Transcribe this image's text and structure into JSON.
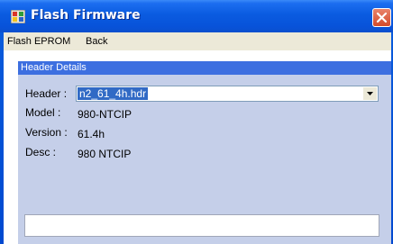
{
  "window": {
    "title": "Flash Firmware"
  },
  "menu": {
    "items": [
      "Flash EPROM",
      "Back"
    ]
  },
  "panel": {
    "header": "Header Details",
    "header_label": "Header :",
    "header_value": "n2_61_4h.hdr",
    "model_label": "Model :",
    "model_value": "980-NTCIP",
    "version_label": "Version :",
    "version_value": "61.4h",
    "desc_label": "Desc :",
    "desc_value": "980 NTCIP",
    "status_value": ""
  },
  "icons": {
    "app": "firmware-app-icon",
    "close": "close-icon",
    "dropdown": "chevron-down-icon"
  },
  "colors": {
    "titlebar": "#0a5be0",
    "panel_bg": "#c5cfe9",
    "panel_header": "#3d6fe0",
    "selection": "#316ac5",
    "close": "#d34b2b"
  }
}
